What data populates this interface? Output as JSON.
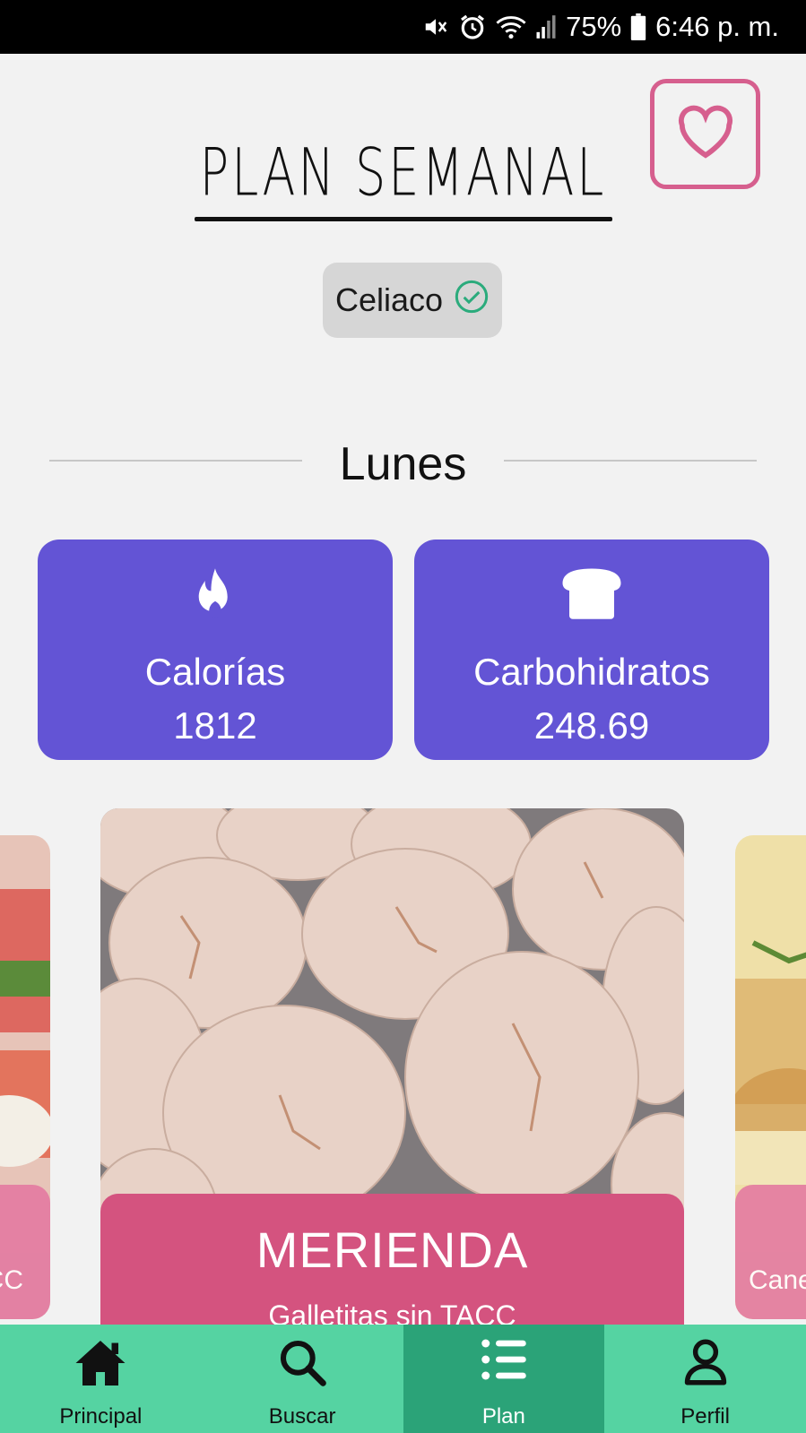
{
  "status_bar": {
    "battery": "75%",
    "time": "6:46 p. m.",
    "icons": [
      "mute-icon",
      "alarm-icon",
      "wifi-icon",
      "signal-icon",
      "battery-icon"
    ]
  },
  "header": {
    "title": "PLAN SEMANAL",
    "favorite_icon": "heart-icon",
    "accent_color": "#d65f8e"
  },
  "diet_chip": {
    "label": "Celiaco",
    "icon": "check-circle-icon"
  },
  "day": {
    "label": "Lunes"
  },
  "stats": [
    {
      "label": "Calorías",
      "value": "1812",
      "icon": "flame-icon"
    },
    {
      "label": "Carbohidratos",
      "value": "248.69",
      "icon": "bread-icon"
    }
  ],
  "stat_color": "#6354d5",
  "meals": {
    "current": {
      "type": "MERIENDA",
      "name": "Galletitas sin TACC"
    },
    "previous_partial": "CC",
    "next_partial": "Cane"
  },
  "bottom_nav": {
    "items": [
      {
        "label": "Principal",
        "icon": "home-icon"
      },
      {
        "label": "Buscar",
        "icon": "search-icon"
      },
      {
        "label": "Plan",
        "icon": "list-icon"
      },
      {
        "label": "Perfil",
        "icon": "user-icon"
      }
    ],
    "active": "Plan",
    "color": "#55d3a2",
    "active_color": "#2ba378"
  }
}
